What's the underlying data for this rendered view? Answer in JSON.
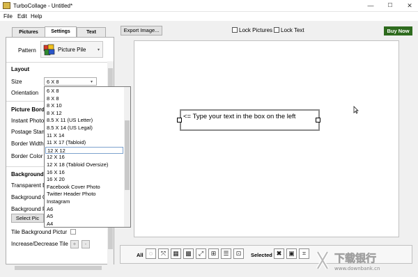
{
  "window": {
    "title": "TurboCollage - Untitled*",
    "controls": {
      "minimize": "—",
      "maximize": "☐",
      "close": "✕"
    }
  },
  "menu": [
    "File",
    "Edit",
    "Help"
  ],
  "tabs": [
    "Pictures",
    "Settings",
    "Text"
  ],
  "settings": {
    "pattern_label": "Pattern",
    "pattern_value": "Picture Pile",
    "layout_header": "Layout",
    "size_label": "Size",
    "size_value": "6 X 8",
    "orientation_label": "Orientation",
    "picture_border_header": "Picture Borde",
    "instant_photo_label": "Instant Photo",
    "postage_stamp_label": "Postage Stam",
    "border_width_label": "Border Width",
    "border_color_label": "Border Color",
    "background_header": "Background",
    "transparent_label": "Transparent B",
    "background_color_label": "Background C",
    "background_picture_label": "Background P",
    "select_picture_label": "Select Pic",
    "tile_background_label": "Tile Background Pictur",
    "increase_decrease_label": "Increase/Decrease Tile",
    "plus": "+",
    "minus": "-"
  },
  "size_options": [
    "6 X 8",
    "8 X 8",
    "8 X 10",
    "8 X 12",
    "8.5 X 11 (US Letter)",
    "8.5 X 14 (US Legal)",
    "11 X 14",
    "11 X 17 (Tabloid)",
    "12 X 12",
    "12 X 16",
    "12 X 18 (Tabloid Oversize)",
    "16 X 16",
    "16 X 20",
    "Facebook Cover Photo",
    "Twitter Header Photo",
    "Instagram",
    "A6",
    "A5",
    "A4"
  ],
  "size_selected_index": 8,
  "toolbar": {
    "export_label": "Export Image...",
    "lock_pictures_label": "Lock Pictures",
    "lock_text_label": "Lock Text",
    "buy_now_label": "Buy Now"
  },
  "canvas": {
    "text_content": "<= Type your text in the box on the left"
  },
  "bottom_bar": {
    "all_label": "All",
    "selected_label": "Selected"
  },
  "watermark": {
    "text_cn": "下载银行",
    "text_url": "www.downbank.cn"
  },
  "colors": {
    "buy_now_bg": "#2e6b1e",
    "selection_border": "#7da2ce"
  }
}
